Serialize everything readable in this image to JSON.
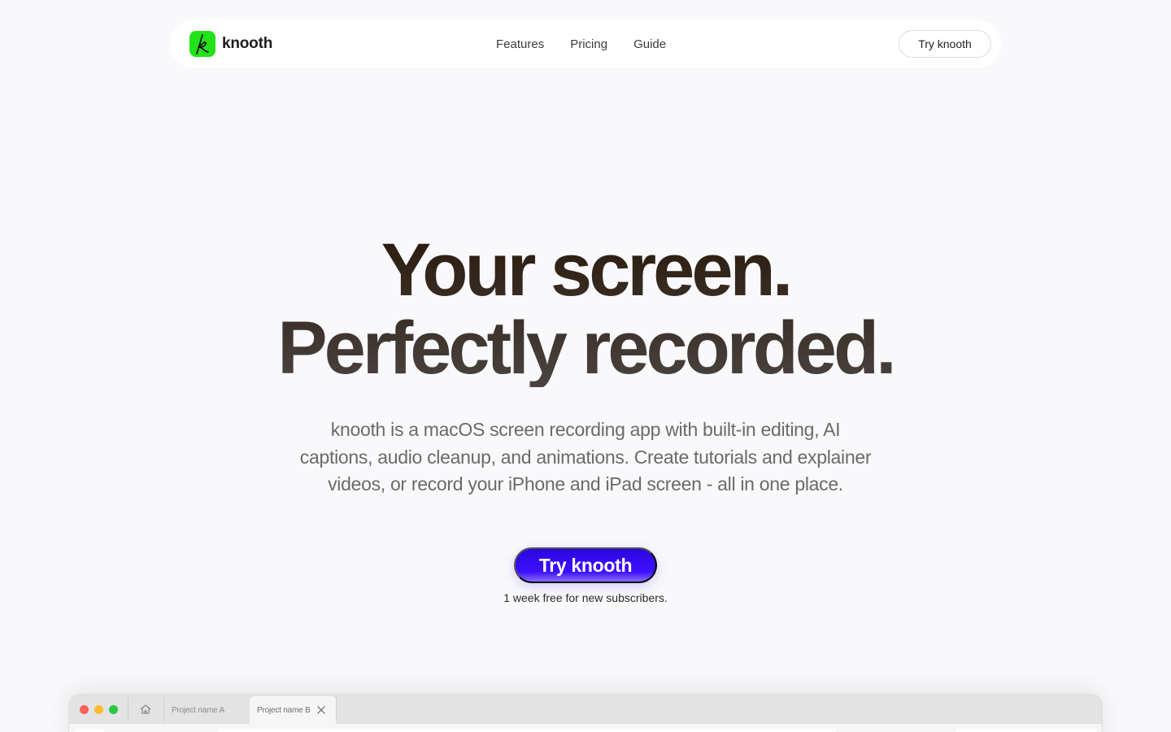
{
  "brand": {
    "name": "knooth",
    "logo_letter": "k",
    "logo_color": "#22e31a"
  },
  "nav": {
    "links": [
      "Features",
      "Pricing",
      "Guide"
    ],
    "cta_label": "Try knooth"
  },
  "hero": {
    "title_line1": "Your screen.",
    "title_line2": "Perfectly recorded.",
    "subtitle": "knooth is a macOS screen recording app with built-in editing, AI captions, audio cleanup, and animations. Create tutorials and explainer videos, or record your iPhone and iPad screen - all in one place.",
    "cta_label": "Try knooth",
    "cta_color": "#3c10ff",
    "cta_note": "1 week free for new subscribers."
  },
  "app_window": {
    "tabs": [
      "Project name A",
      "Project name B"
    ],
    "active_tab": "Project name B"
  }
}
